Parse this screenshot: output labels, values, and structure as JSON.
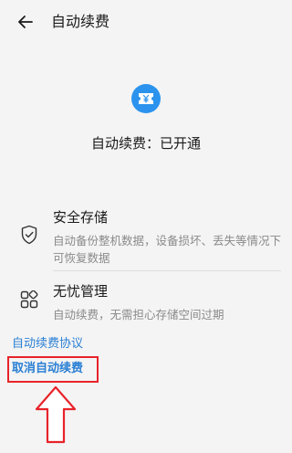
{
  "header": {
    "title": "自动续费",
    "back_icon": "back-arrow-icon"
  },
  "status": {
    "icon": "yen-ticket-icon",
    "text": "自动续费：已开通",
    "accent_color": "#2b93ee"
  },
  "features": [
    {
      "icon": "shield-check-icon",
      "title": "安全存储",
      "description": "自动备份整机数据，设备损坏、丢失等情况下可恢复数据"
    },
    {
      "icon": "grid-apps-icon",
      "title": "无忧管理",
      "description": "自动续费，无需担心存储空间过期"
    }
  ],
  "links": {
    "agreement": "自动续费协议",
    "cancel": "取消自动续费",
    "link_color": "#2a7fd4"
  },
  "annotation": {
    "highlight_color": "#e8232b",
    "arrow_icon": "up-arrow-icon"
  }
}
